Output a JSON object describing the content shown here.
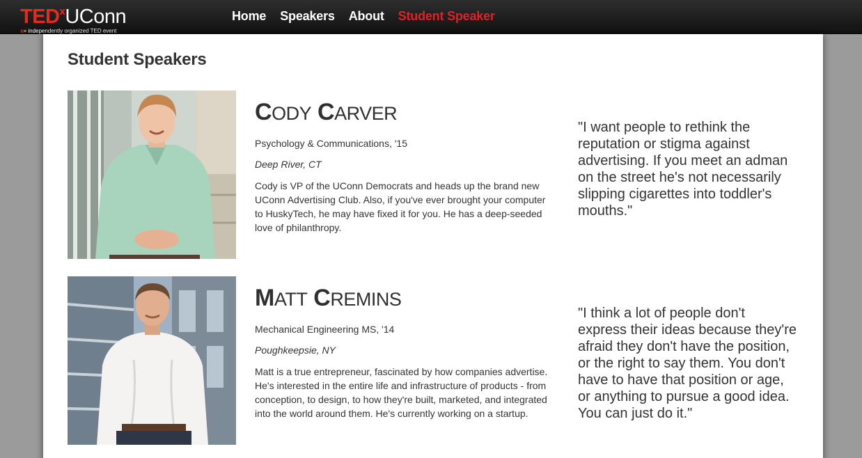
{
  "header": {
    "logo": {
      "ted": "TED",
      "x": "x",
      "event": "UConn",
      "tagline_x": "x",
      "tagline": "= independently organized TED event"
    },
    "nav": [
      {
        "label": "Home"
      },
      {
        "label": "Speakers"
      },
      {
        "label": "About"
      },
      {
        "label": "Student Speaker"
      }
    ],
    "active_nav": "Student Speaker",
    "accent_color": "#e51f22"
  },
  "main": {
    "title": "Student Speakers",
    "speakers": [
      {
        "first_initial": "C",
        "first_rest": "ody",
        "last_initial": "C",
        "last_rest": "arver",
        "major": "Psychology & Communications, '15",
        "hometown": "Deep River, CT",
        "bio": "Cody is VP of the UConn Democrats and heads up the brand new UConn Advertising Club. Also, if you've ever brought your computer to HuskyTech, he may have fixed it for you. He has a deep-seeded love of philanthropy.",
        "quote": "\"I want people to rethink the reputation or stigma against advertising. If you meet an adman on the street he's not necessarily slipping cigarettes into toddler's mouths.\""
      },
      {
        "first_initial": "M",
        "first_rest": "att",
        "last_initial": "C",
        "last_rest": "remins",
        "major": "Mechanical Engineering MS, '14",
        "hometown": "Poughkeepsie, NY",
        "bio": "Matt is a true entrepreneur, fascinated by how companies advertise. He's interested in the entire life and infrastructure of products - from conception, to design, to how they're built, marketed, and integrated into the world around them. He's currently working on a startup.",
        "quote": "\"I think a lot of people don't express their ideas because they're afraid they don't have the position, or the right to say them. You don't have to have that position or age, or anything to pursue a good idea. You can just do it.\""
      }
    ]
  }
}
